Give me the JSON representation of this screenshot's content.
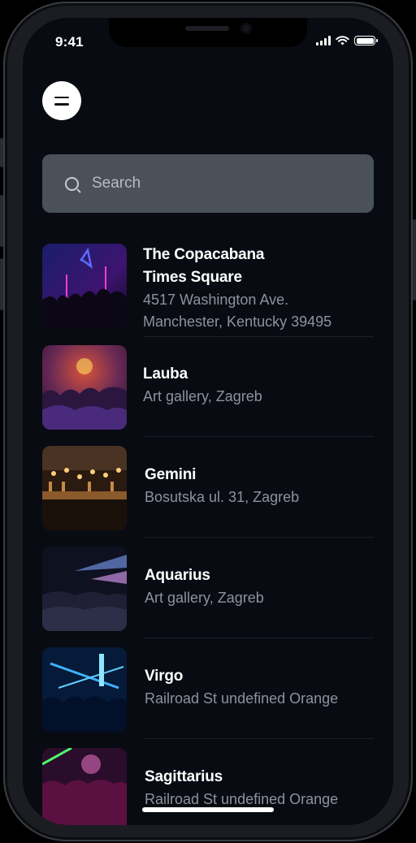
{
  "status_bar": {
    "time": "9:41",
    "icons": [
      "cellular-signal-icon",
      "wifi-icon",
      "battery-icon"
    ]
  },
  "header": {
    "menu_icon": "menu-icon"
  },
  "search": {
    "placeholder": "Search",
    "value": "",
    "icon": "search-icon"
  },
  "venues": [
    {
      "title_lines": [
        "The Copacabana",
        "Times Square"
      ],
      "subtitle_lines": [
        "4517 Washington Ave.",
        "Manchester, Kentucky 39495"
      ]
    },
    {
      "title_lines": [
        "Lauba"
      ],
      "subtitle_lines": [
        "Art gallery, Zagreb"
      ]
    },
    {
      "title_lines": [
        "Gemini"
      ],
      "subtitle_lines": [
        "Bosutska ul. 31, Zagreb"
      ]
    },
    {
      "title_lines": [
        "Aquarius"
      ],
      "subtitle_lines": [
        "Art gallery, Zagreb"
      ]
    },
    {
      "title_lines": [
        "Virgo"
      ],
      "subtitle_lines": [
        "Railroad St undefined Orange"
      ]
    },
    {
      "title_lines": [
        "Sagittarius"
      ],
      "subtitle_lines": [
        "Railroad St undefined Orange"
      ]
    }
  ],
  "colors": {
    "background": "#080b12",
    "search_bg": "#4b5159",
    "title": "#ffffff",
    "subtitle": "#8d939b"
  }
}
